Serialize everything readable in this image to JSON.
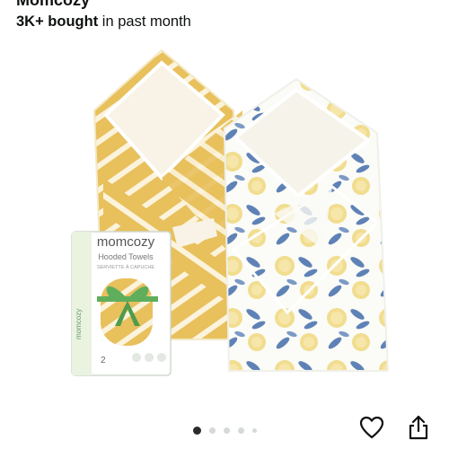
{
  "header": {
    "cut_title": "Momcozy",
    "bought_count": "3K+ bought",
    "bought_suffix": " in past month"
  },
  "product": {
    "image_alt": "Momcozy hooded baby towels, yellow stripe and lemon print",
    "box": {
      "brand": "momcozy",
      "line1": "Hooded Towels",
      "line2": "SERVIETTE À CAPUCHE",
      "side_brand": "momcozy",
      "count": "2"
    }
  },
  "carousel": {
    "total": 5,
    "active_index": 0
  },
  "icons": {
    "wishlist": "heart-icon",
    "share": "share-icon"
  },
  "colors": {
    "stripe_yellow": "#e8c05c",
    "lemon": "#f1dd8e",
    "leaf_blue": "#5f82b6",
    "ribbon_green": "#5fae5c",
    "box_green": "#eaf3e0"
  }
}
